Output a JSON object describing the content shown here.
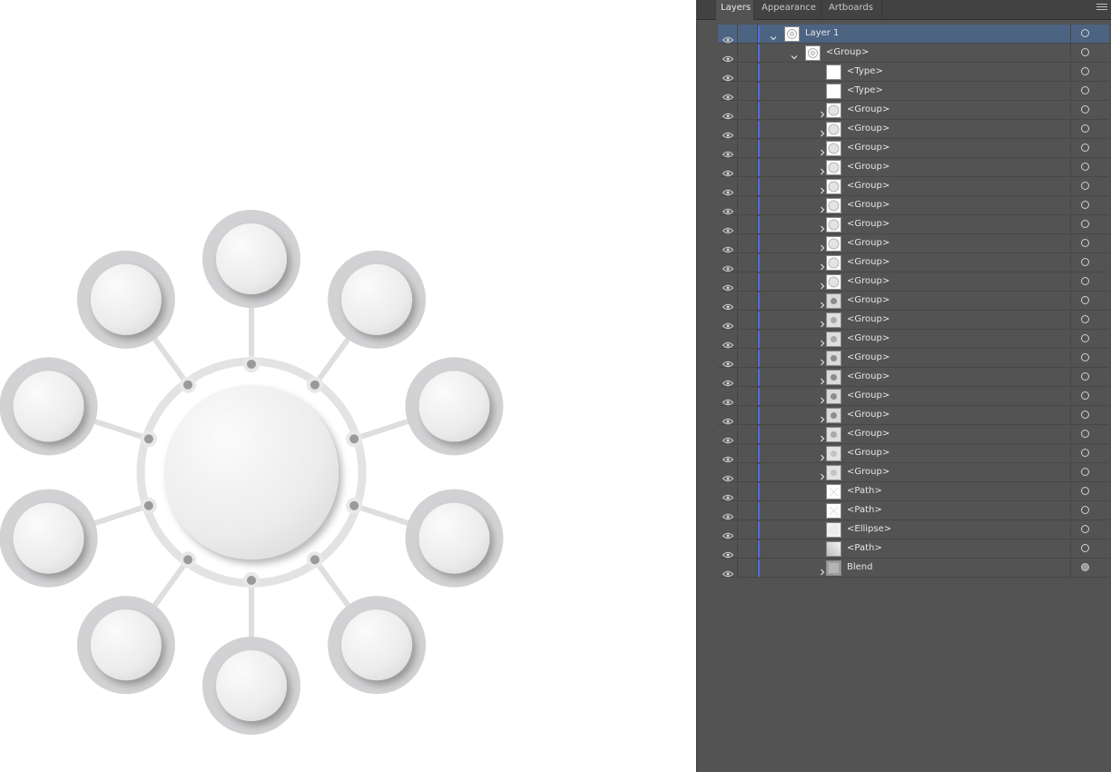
{
  "panel": {
    "tabs": [
      {
        "label": "Layers",
        "active": true
      },
      {
        "label": "Appearance",
        "active": false
      },
      {
        "label": "Artboards",
        "active": false
      }
    ],
    "menu_icon": "hamburger-menu-icon"
  },
  "layers": [
    {
      "name": "Layer 1",
      "indent": 0,
      "expander": "open",
      "thumb": "art",
      "selected": true,
      "target_filled": false
    },
    {
      "name": "<Group>",
      "indent": 1,
      "expander": "open",
      "thumb": "art",
      "selected": false,
      "target_filled": false
    },
    {
      "name": "<Type>",
      "indent": 2,
      "expander": "none",
      "thumb": "blank",
      "selected": false,
      "target_filled": false
    },
    {
      "name": "<Type>",
      "indent": 2,
      "expander": "none",
      "thumb": "blank",
      "selected": false,
      "target_filled": false
    },
    {
      "name": "<Group>",
      "indent": 2,
      "expander": "closed",
      "thumb": "circle-light",
      "selected": false,
      "target_filled": false
    },
    {
      "name": "<Group>",
      "indent": 2,
      "expander": "closed",
      "thumb": "circle-light",
      "selected": false,
      "target_filled": false
    },
    {
      "name": "<Group>",
      "indent": 2,
      "expander": "closed",
      "thumb": "circle-light",
      "selected": false,
      "target_filled": false
    },
    {
      "name": "<Group>",
      "indent": 2,
      "expander": "closed",
      "thumb": "circle-light",
      "selected": false,
      "target_filled": false
    },
    {
      "name": "<Group>",
      "indent": 2,
      "expander": "closed",
      "thumb": "circle-light",
      "selected": false,
      "target_filled": false
    },
    {
      "name": "<Group>",
      "indent": 2,
      "expander": "closed",
      "thumb": "circle-light",
      "selected": false,
      "target_filled": false
    },
    {
      "name": "<Group>",
      "indent": 2,
      "expander": "closed",
      "thumb": "circle-light",
      "selected": false,
      "target_filled": false
    },
    {
      "name": "<Group>",
      "indent": 2,
      "expander": "closed",
      "thumb": "circle-light",
      "selected": false,
      "target_filled": false
    },
    {
      "name": "<Group>",
      "indent": 2,
      "expander": "closed",
      "thumb": "circle-light",
      "selected": false,
      "target_filled": false
    },
    {
      "name": "<Group>",
      "indent": 2,
      "expander": "closed",
      "thumb": "circle-light",
      "selected": false,
      "target_filled": false
    },
    {
      "name": "<Group>",
      "indent": 2,
      "expander": "closed",
      "thumb": "dot-dark",
      "selected": false,
      "target_filled": false
    },
    {
      "name": "<Group>",
      "indent": 2,
      "expander": "closed",
      "thumb": "dot-mid",
      "selected": false,
      "target_filled": false
    },
    {
      "name": "<Group>",
      "indent": 2,
      "expander": "closed",
      "thumb": "dot-mid",
      "selected": false,
      "target_filled": false
    },
    {
      "name": "<Group>",
      "indent": 2,
      "expander": "closed",
      "thumb": "dot-dark",
      "selected": false,
      "target_filled": false
    },
    {
      "name": "<Group>",
      "indent": 2,
      "expander": "closed",
      "thumb": "dot-dark",
      "selected": false,
      "target_filled": false
    },
    {
      "name": "<Group>",
      "indent": 2,
      "expander": "closed",
      "thumb": "dot-dark",
      "selected": false,
      "target_filled": false
    },
    {
      "name": "<Group>",
      "indent": 2,
      "expander": "closed",
      "thumb": "dot-dark",
      "selected": false,
      "target_filled": false
    },
    {
      "name": "<Group>",
      "indent": 2,
      "expander": "closed",
      "thumb": "dot-mid",
      "selected": false,
      "target_filled": false
    },
    {
      "name": "<Group>",
      "indent": 2,
      "expander": "closed",
      "thumb": "dot-light",
      "selected": false,
      "target_filled": false
    },
    {
      "name": "<Group>",
      "indent": 2,
      "expander": "closed",
      "thumb": "dot-light",
      "selected": false,
      "target_filled": false
    },
    {
      "name": "<Path>",
      "indent": 2,
      "expander": "none",
      "thumb": "path-lines",
      "selected": false,
      "target_filled": false
    },
    {
      "name": "<Path>",
      "indent": 2,
      "expander": "none",
      "thumb": "path-lines",
      "selected": false,
      "target_filled": false
    },
    {
      "name": "<Ellipse>",
      "indent": 2,
      "expander": "none",
      "thumb": "ellipse",
      "selected": false,
      "target_filled": false
    },
    {
      "name": "<Path>",
      "indent": 2,
      "expander": "none",
      "thumb": "gradient",
      "selected": false,
      "target_filled": false
    },
    {
      "name": "Blend",
      "indent": 2,
      "expander": "closed",
      "thumb": "blend",
      "selected": false,
      "target_filled": true
    }
  ],
  "colors": {
    "panel_bg": "#535353",
    "tab_bar_bg": "#424242",
    "selected_row": "#4c6382",
    "layer_color": "#4e6fde",
    "artboard_bg": "#ffffff"
  },
  "artwork": {
    "description_shapes": "hub-and-spoke: 1 large center circle, 10 outer circles, 10 connector dots",
    "outer_circle_count": 10
  }
}
